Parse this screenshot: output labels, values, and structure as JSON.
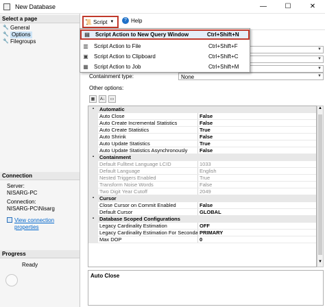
{
  "window": {
    "title": "New Database",
    "minimize": "—",
    "maximize": "☐",
    "close": "✕"
  },
  "left_pane": {
    "select_page_header": "Select a page",
    "pages": [
      {
        "label": "General",
        "icon": "wrench-icon"
      },
      {
        "label": "Options",
        "icon": "wrench-icon",
        "selected": true
      },
      {
        "label": "Filegroups",
        "icon": "wrench-icon"
      }
    ],
    "connection_header": "Connection",
    "server_label": "Server:",
    "server_value": "NISARG-PC",
    "connection_label": "Connection:",
    "connection_value": "NISARG-PC\\Nisarg",
    "view_props_link": "View connection properties",
    "progress_header": "Progress",
    "progress_status": "Ready"
  },
  "toolbar": {
    "script_label": "Script",
    "help_label": "Help"
  },
  "script_menu": {
    "items": [
      {
        "label": "Script Action to New Query Window",
        "shortcut": "Ctrl+Shift+N",
        "highlighted": true
      },
      {
        "label": "Script Action to File",
        "shortcut": "Ctrl+Shift+F"
      },
      {
        "label": "Script Action to Clipboard",
        "shortcut": "Ctrl+Shift+C"
      },
      {
        "label": "Script Action to Job",
        "shortcut": "Ctrl+Shift+M"
      }
    ]
  },
  "options_form": {
    "containment_type_label": "Containment type:",
    "containment_type_value": "None",
    "other_options_label": "Other options:"
  },
  "property_grid": {
    "rows": [
      {
        "kind": "category",
        "name": "Automatic"
      },
      {
        "kind": "prop",
        "name": "Auto Close",
        "value": "False"
      },
      {
        "kind": "prop",
        "name": "Auto Create Incremental Statistics",
        "value": "False"
      },
      {
        "kind": "prop",
        "name": "Auto Create Statistics",
        "value": "True"
      },
      {
        "kind": "prop",
        "name": "Auto Shrink",
        "value": "False"
      },
      {
        "kind": "prop",
        "name": "Auto Update Statistics",
        "value": "True"
      },
      {
        "kind": "prop",
        "name": "Auto Update Statistics Asynchronously",
        "value": "False"
      },
      {
        "kind": "category",
        "name": "Containment"
      },
      {
        "kind": "prop",
        "name": "Default Fulltext Language LCID",
        "value": "1033",
        "disabled": true
      },
      {
        "kind": "prop",
        "name": "Default Language",
        "value": "English",
        "disabled": true
      },
      {
        "kind": "prop",
        "name": "Nested Triggers Enabled",
        "value": "True",
        "disabled": true
      },
      {
        "kind": "prop",
        "name": "Transform Noise Words",
        "value": "False",
        "disabled": true
      },
      {
        "kind": "prop",
        "name": "Two Digit Year Cutoff",
        "value": "2049",
        "disabled": true
      },
      {
        "kind": "category",
        "name": "Cursor"
      },
      {
        "kind": "prop",
        "name": "Close Cursor on Commit Enabled",
        "value": "False"
      },
      {
        "kind": "prop",
        "name": "Default Cursor",
        "value": "GLOBAL"
      },
      {
        "kind": "category",
        "name": "Database Scoped Configurations"
      },
      {
        "kind": "prop",
        "name": "Legacy Cardinality Estimation",
        "value": "OFF"
      },
      {
        "kind": "prop",
        "name": "Legacy Cardinality Estimation For Secondary",
        "value": "PRIMARY"
      },
      {
        "kind": "prop",
        "name": "Max DOP",
        "value": "0"
      }
    ],
    "description_title": "Auto Close"
  }
}
